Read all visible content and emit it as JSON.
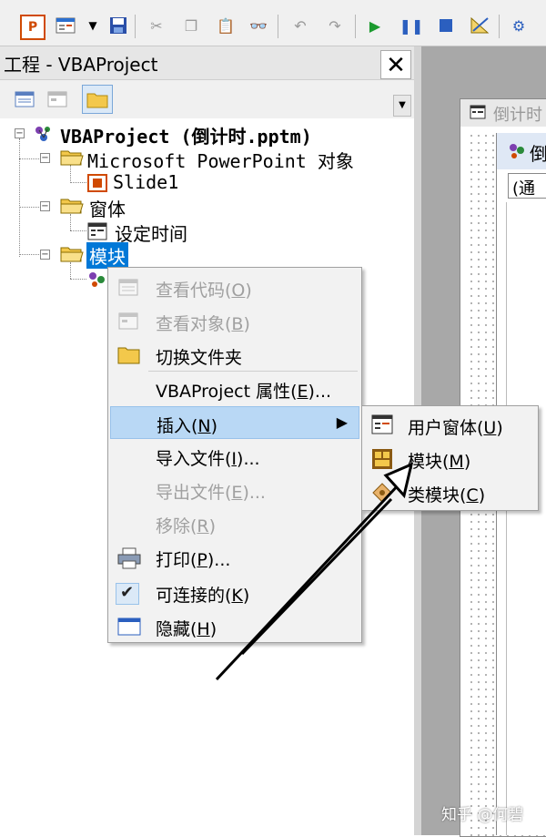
{
  "project_pane": {
    "title": "工程 - VBAProject",
    "close_glyph": "✕"
  },
  "tree": {
    "root": "VBAProject (倒计时.pptm)",
    "ms_objects_folder": "Microsoft PowerPoint 对象",
    "slide": "Slide1",
    "forms_folder": "窗体",
    "form_item": "设定时间",
    "modules_folder": "模块"
  },
  "context_menu": {
    "items": [
      {
        "label": "查看代码(",
        "key": "O",
        "end": ")",
        "disabled": true,
        "icon": "code-view-icon"
      },
      {
        "label": "查看对象(",
        "key": "B",
        "end": ")",
        "disabled": true,
        "icon": "object-view-icon"
      },
      {
        "label": "切换文件夹",
        "key": "",
        "end": "",
        "disabled": false,
        "icon": "folder-icon"
      },
      {
        "label": "VBAProject 属性(",
        "key": "E",
        "end": ")...",
        "disabled": false,
        "icon": ""
      },
      {
        "label": "插入(",
        "key": "N",
        "end": ")",
        "disabled": false,
        "icon": "",
        "submenu": true
      },
      {
        "label": "导入文件(",
        "key": "I",
        "end": ")...",
        "disabled": false,
        "icon": ""
      },
      {
        "label": "导出文件(",
        "key": "E",
        "end": ")...",
        "disabled": true,
        "icon": ""
      },
      {
        "label": "移除(",
        "key": "R",
        "end": ")",
        "disabled": true,
        "icon": ""
      },
      {
        "label": "打印(",
        "key": "P",
        "end": ")...",
        "disabled": false,
        "icon": "printer-icon"
      },
      {
        "label": "可连接的(",
        "key": "K",
        "end": ")",
        "disabled": false,
        "icon": "checkmark-icon"
      },
      {
        "label": "隐藏(",
        "key": "H",
        "end": ")",
        "disabled": false,
        "icon": "hide-window-icon"
      }
    ]
  },
  "submenu": {
    "items": [
      {
        "label": "用户窗体(",
        "key": "U",
        "end": ")",
        "icon": "userform-icon"
      },
      {
        "label": "模块(",
        "key": "M",
        "end": ")",
        "icon": "module-icon"
      },
      {
        "label": "类模块(",
        "key": "C",
        "end": ")",
        "icon": "class-module-icon"
      }
    ]
  },
  "right_pane": {
    "window_title_fragment": "倒计时",
    "inner_title_fragment": "倒",
    "combo_fragment": "(通"
  },
  "watermark": "知乎 @何碧",
  "colors": {
    "menu_highlight": "#b9d8f5",
    "selected_node": "#0078d7",
    "disabled_text": "#a0a0a0"
  }
}
